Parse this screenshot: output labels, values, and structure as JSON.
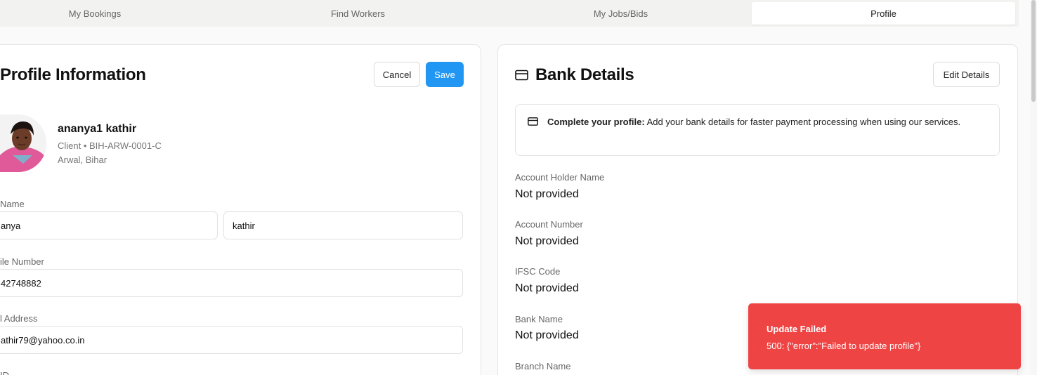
{
  "tabs": [
    "My Bookings",
    "Find Workers",
    "My Jobs/Bids",
    "Profile"
  ],
  "active_tab": "Profile",
  "profile_card": {
    "title": "Profile Information",
    "cancel_label": "Cancel",
    "save_label": "Save",
    "name": "ananya1 kathir",
    "role_line": "Client • BIH-ARW-0001-C",
    "location": "Arwal, Bihar",
    "fields": {
      "name_label": "Name",
      "first_name_value": "anya",
      "last_name_value": "kathir",
      "mobile_label": "ile Number",
      "mobile_value": "42748882",
      "email_label": "l Address",
      "email_value": "athir79@yahoo.co.in",
      "next_label": "ID"
    }
  },
  "bank_card": {
    "title": "Bank Details",
    "edit_label": "Edit Details",
    "notice_bold": "Complete your profile:",
    "notice_text": " Add your bank details for faster payment processing when using our services.",
    "fields": [
      {
        "label": "Account Holder Name",
        "value": "Not provided"
      },
      {
        "label": "Account Number",
        "value": "Not provided"
      },
      {
        "label": "IFSC Code",
        "value": "Not provided"
      },
      {
        "label": "Bank Name",
        "value": "Not provided"
      },
      {
        "label": "Branch Name",
        "value": ""
      }
    ]
  },
  "toast": {
    "title": "Update Failed",
    "message": "500: {\"error\":\"Failed to update profile\"}",
    "color": "#ef4444"
  },
  "colors": {
    "primary": "#2196f3",
    "error": "#ef4444"
  },
  "icons": {
    "bank_title": "credit-card-icon",
    "notice": "credit-card-icon"
  }
}
